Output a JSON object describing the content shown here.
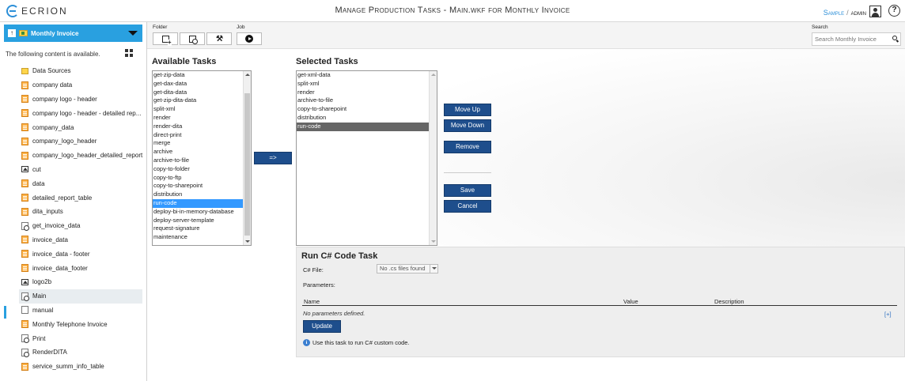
{
  "app": {
    "logo_text": "ECRION",
    "title": "Manage Production Tasks - Main.wkf for Monthly Invoice"
  },
  "user": {
    "project": "Sample",
    "separator": "/",
    "username": "admin",
    "help_label": "?"
  },
  "sidebar": {
    "up_label": "↑",
    "folder_name": "Monthly Invoice",
    "note": "The following content is available.",
    "items": [
      {
        "label": "Data Sources",
        "icon": "folder"
      },
      {
        "label": "company data",
        "icon": "xml"
      },
      {
        "label": "company logo - header",
        "icon": "xml"
      },
      {
        "label": "company logo - header - detailed rep...",
        "icon": "xml"
      },
      {
        "label": "company_data",
        "icon": "xml"
      },
      {
        "label": "company_logo_header",
        "icon": "xml"
      },
      {
        "label": "company_logo_header_detailed_report",
        "icon": "xml"
      },
      {
        "label": "cut",
        "icon": "img"
      },
      {
        "label": "data",
        "icon": "xml"
      },
      {
        "label": "detailed_report_table",
        "icon": "xml"
      },
      {
        "label": "dita_inputs",
        "icon": "xml"
      },
      {
        "label": "get_invoice_data",
        "icon": "docgear"
      },
      {
        "label": "invoice_data",
        "icon": "xml"
      },
      {
        "label": "invoice_data - footer",
        "icon": "xml"
      },
      {
        "label": "invoice_data_footer",
        "icon": "xml"
      },
      {
        "label": "logo2b",
        "icon": "img"
      },
      {
        "label": "Main",
        "icon": "docgear",
        "active": true
      },
      {
        "label": "manual",
        "icon": "doc"
      },
      {
        "label": "Monthly Telephone Invoice",
        "icon": "xml"
      },
      {
        "label": "Print",
        "icon": "docgear"
      },
      {
        "label": "RenderDITA",
        "icon": "docgear"
      },
      {
        "label": "service_summ_info_table",
        "icon": "xml"
      }
    ]
  },
  "toolbar": {
    "folder_label": "Folder",
    "job_label": "Job",
    "search_label": "Search",
    "search_placeholder": "Search Monthly Invoice"
  },
  "available": {
    "title": "Available Tasks",
    "selected_value": "run-code",
    "options": [
      "get-zip-data",
      "get-dax-data",
      "get-dita-data",
      "get-zip-dita-data",
      "split-xml",
      "render",
      "render-dita",
      "direct-print",
      "merge",
      "archive",
      "archive-to-file",
      "copy-to-folder",
      "copy-to-ftp",
      "copy-to-sharepoint",
      "distribution",
      "run-code",
      "deploy-bi-in-memory-database",
      "deploy-server-template",
      "request-signature",
      "maintenance"
    ]
  },
  "add_button_label": "=>",
  "selected": {
    "title": "Selected Tasks",
    "selected_value": "run-code",
    "options": [
      "get-xml-data",
      "split-xml",
      "render",
      "archive-to-file",
      "copy-to-sharepoint",
      "distribution",
      "run-code"
    ]
  },
  "actions": {
    "move_up": "Move Up",
    "move_down": "Move Down",
    "remove": "Remove",
    "save": "Save",
    "cancel": "Cancel"
  },
  "task_panel": {
    "title": "Run C# Code Task",
    "cs_file_label": "C# File:",
    "cs_file_value": "No .cs files found",
    "params_label": "Parameters:",
    "columns": [
      "Name",
      "Value",
      "Description"
    ],
    "empty_text": "No parameters defined.",
    "add_link": "[+]",
    "update_label": "Update",
    "info_icon": "i",
    "info_text": "Use this task to run C# custom code."
  },
  "colors": {
    "accent": "#29a0e0",
    "button": "#1e4e8c",
    "list_selection": "#3399ff"
  }
}
